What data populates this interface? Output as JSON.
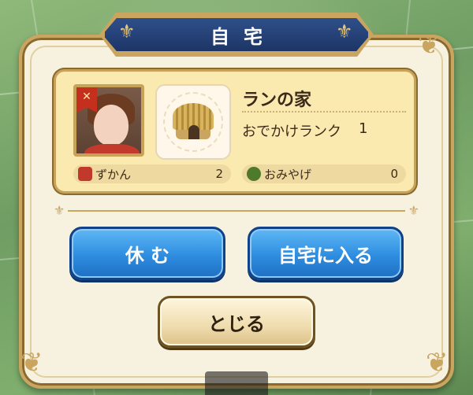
{
  "dialog": {
    "title": "自宅"
  },
  "home_card": {
    "home_name": "ランの家",
    "rank_label": "おでかけランク",
    "rank_value": "1",
    "stats": [
      {
        "label": "ずかん",
        "value": "2",
        "icon": "book-icon",
        "icon_color": "#c0392b"
      },
      {
        "label": "おみやげ",
        "value": "0",
        "icon": "souvenir-leaf-icon",
        "icon_color": "#4e7a2a"
      }
    ],
    "portrait_badge_icon": "crossed-swords-icon",
    "house_icon": "straw-hut-icon"
  },
  "buttons": {
    "rest": "休 む",
    "enter_home": "自宅に入る",
    "close": "とじる"
  },
  "colors": {
    "title_banner": "#1d3566",
    "primary_button": "#2e8de0",
    "secondary_button": "#efdcae",
    "card_background": "#fbeab0",
    "panel_background": "#f7f1e0",
    "gold_trim": "#c9a560"
  }
}
